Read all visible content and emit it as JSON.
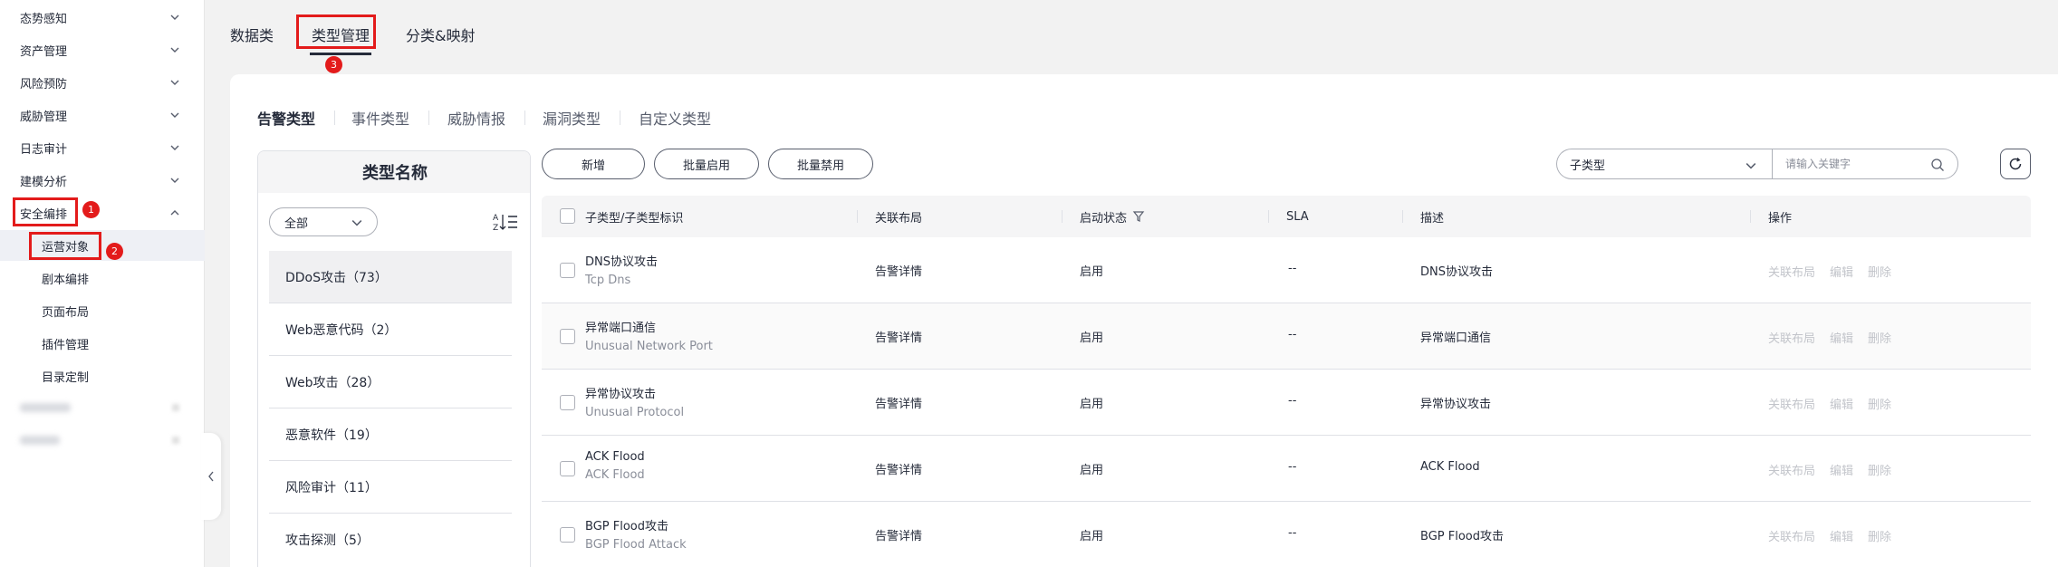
{
  "sidebar": {
    "items": [
      {
        "label": "态势感知"
      },
      {
        "label": "资产管理"
      },
      {
        "label": "风险预防"
      },
      {
        "label": "威胁管理"
      },
      {
        "label": "日志审计"
      },
      {
        "label": "建模分析"
      },
      {
        "label": "安全编排"
      }
    ],
    "sub_items": [
      {
        "label": "运营对象"
      },
      {
        "label": "剧本编排"
      },
      {
        "label": "页面布局"
      },
      {
        "label": "插件管理"
      },
      {
        "label": "目录定制"
      }
    ]
  },
  "annotations": {
    "badge1": "1",
    "badge2": "2",
    "badge3": "3"
  },
  "top_tabs": [
    {
      "label": "数据类"
    },
    {
      "label": "类型管理"
    },
    {
      "label": "分类&映射"
    }
  ],
  "sub_tabs": [
    {
      "label": "告警类型"
    },
    {
      "label": "事件类型"
    },
    {
      "label": "威胁情报"
    },
    {
      "label": "漏洞类型"
    },
    {
      "label": "自定义类型"
    }
  ],
  "type_panel": {
    "header": "类型名称",
    "filter_value": "全部",
    "items": [
      {
        "label": "DDoS攻击（73）"
      },
      {
        "label": "Web恶意代码（2）"
      },
      {
        "label": "Web攻击（28）"
      },
      {
        "label": "恶意软件（19）"
      },
      {
        "label": "风险审计（11）"
      },
      {
        "label": "攻击探测（5）"
      }
    ]
  },
  "toolbar": {
    "add_label": "新增",
    "batch_enable_label": "批量启用",
    "batch_disable_label": "批量禁用",
    "subtype_select": "子类型",
    "search_placeholder": "请输入关键字"
  },
  "table": {
    "headers": {
      "subtype": "子类型/子类型标识",
      "layout": "关联布局",
      "status": "启动状态",
      "sla": "SLA",
      "desc": "描述",
      "ops": "操作"
    },
    "rows": [
      {
        "name": "DNS协议攻击",
        "id": "Tcp Dns",
        "layout": "告警详情",
        "status": "启用",
        "sla": "--",
        "desc": "DNS协议攻击"
      },
      {
        "name": "异常端口通信",
        "id": "Unusual Network Port",
        "layout": "告警详情",
        "status": "启用",
        "sla": "--",
        "desc": "异常端口通信"
      },
      {
        "name": "异常协议攻击",
        "id": "Unusual Protocol",
        "layout": "告警详情",
        "status": "启用",
        "sla": "--",
        "desc": "异常协议攻击"
      },
      {
        "name": "ACK Flood",
        "id": "ACK Flood",
        "layout": "告警详情",
        "status": "启用",
        "sla": "--",
        "desc": "ACK Flood"
      },
      {
        "name": "BGP Flood攻击",
        "id": "BGP Flood Attack",
        "layout": "告警详情",
        "status": "启用",
        "sla": "--",
        "desc": "BGP Flood攻击"
      }
    ],
    "ops": {
      "layout": "关联布局",
      "edit": "编辑",
      "delete": "删除"
    }
  }
}
